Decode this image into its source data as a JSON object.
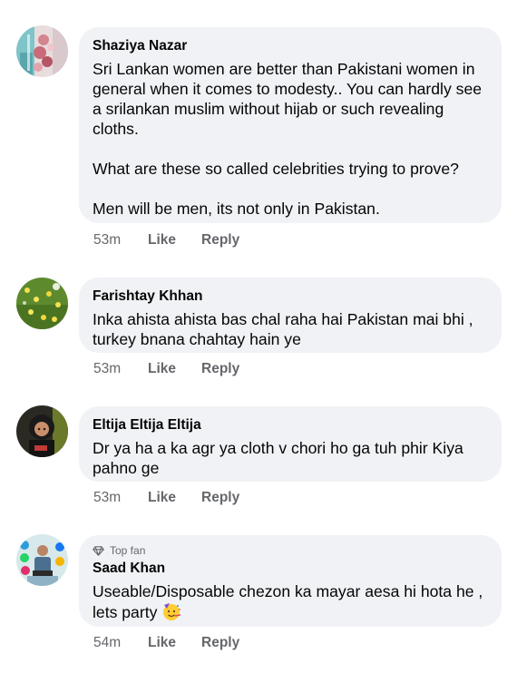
{
  "comments": [
    {
      "author": "Shaziya Nazar",
      "paragraphs": [
        "Sri Lankan women are better than Pakistani women in general when it comes to modesty.. You can hardly see a srilankan muslim without  hijab or such revealing cloths.",
        "What are these so called celebrities trying to prove?",
        "Men will be men, its not only in Pakistan."
      ],
      "time": "53m",
      "like_label": "Like",
      "reply_label": "Reply"
    },
    {
      "author": "Farishtay Khhan",
      "paragraphs": [
        "Inka ahista ahista bas chal raha hai Pakistan mai bhi , turkey bnana chahtay hain ye"
      ],
      "time": "53m",
      "like_label": "Like",
      "reply_label": "Reply"
    },
    {
      "author": "Eltija Eltija Eltija",
      "paragraphs": [
        "Dr ya ha a ka agr ya cloth v chori ho ga tuh phir Kiya pahno ge"
      ],
      "time": "53m",
      "like_label": "Like",
      "reply_label": "Reply"
    },
    {
      "badge": "Top fan",
      "badge_icon": "diamond-icon",
      "author": "Saad Khan",
      "paragraphs": [
        "Useable/Disposable chezon ka mayar aesa hi hota he , lets party"
      ],
      "emoji": "partying-face-emoji",
      "time": "54m",
      "like_label": "Like",
      "reply_label": "Reply"
    }
  ],
  "colors": {
    "bubble": "#f0f2f5",
    "text": "#050505",
    "secondary": "#65676b"
  }
}
